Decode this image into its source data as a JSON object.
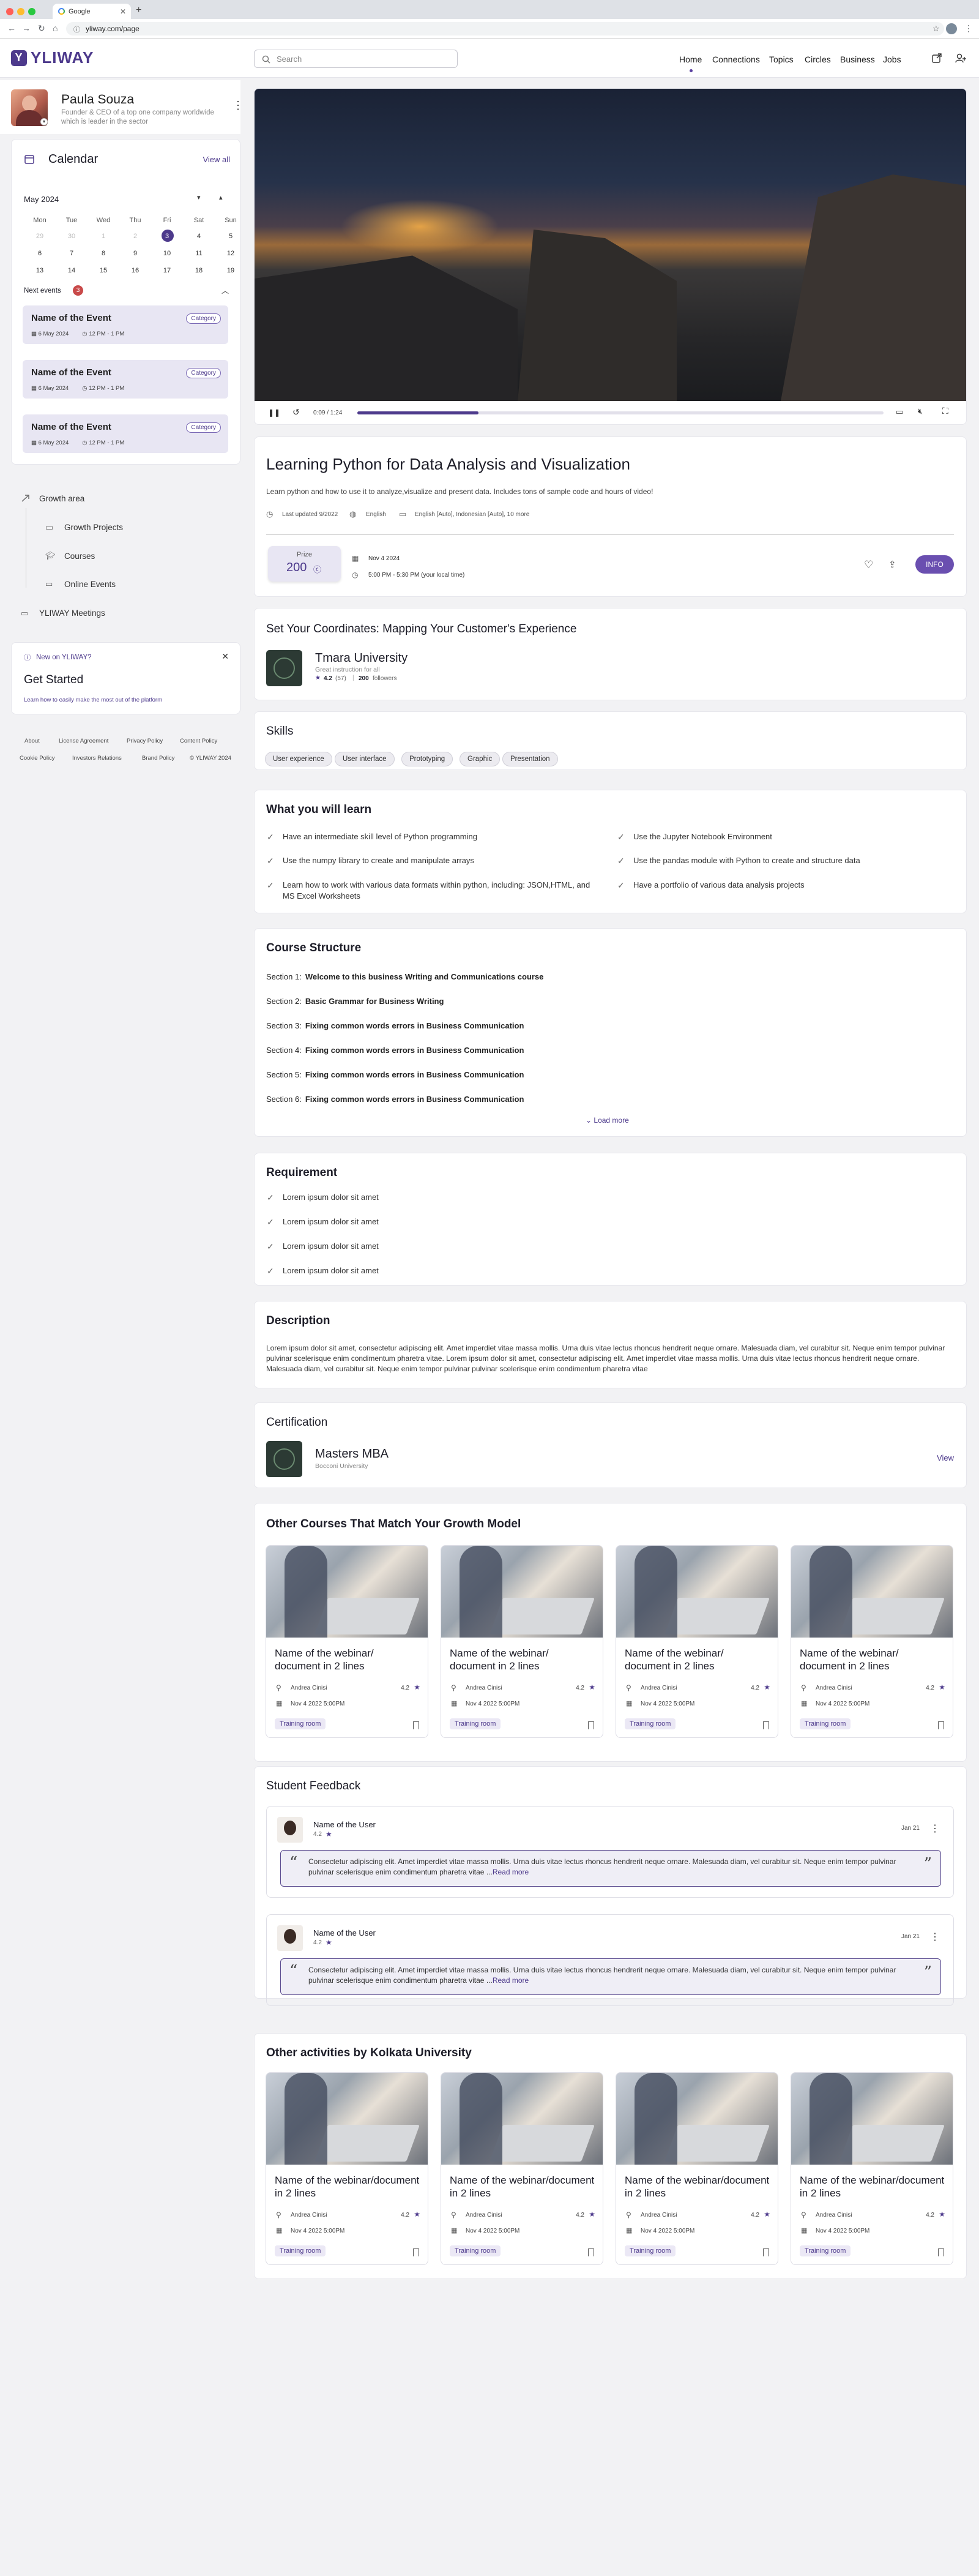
{
  "browser": {
    "tab_title": "Google",
    "url": "yliway.com/page"
  },
  "app": {
    "logo": "YLIWAY",
    "search_placeholder": "Search",
    "nav": [
      "Home",
      "Connections",
      "Topics",
      "Circles",
      "Business",
      "Jobs"
    ],
    "accent": "#4d3a8c"
  },
  "profile": {
    "name": "Paula Souza",
    "desc": "Founder & CEO of a top one company worldwide which is leader in the sector"
  },
  "calendar": {
    "title": "Calendar",
    "view_all": "View all",
    "month": "May 2024",
    "weekdays": [
      "Mon",
      "Tue",
      "Wed",
      "Thu",
      "Fri",
      "Sat",
      "Sun"
    ],
    "weeks": [
      [
        "29",
        "30",
        "1",
        "2",
        "3",
        "4",
        "5"
      ],
      [
        "6",
        "7",
        "8",
        "9",
        "10",
        "11",
        "12"
      ],
      [
        "13",
        "14",
        "15",
        "16",
        "17",
        "18",
        "19"
      ]
    ],
    "next_events_label": "Next events",
    "next_events_count": "3",
    "events": [
      {
        "title": "Name of the Event",
        "category": "Category",
        "date": "6 May 2024",
        "time": "12 PM - 1 PM"
      },
      {
        "title": "Name of the Event",
        "category": "Category",
        "date": "6 May 2024",
        "time": "12 PM - 1 PM"
      },
      {
        "title": "Name of the Event",
        "category": "Category",
        "date": "6 May 2024",
        "time": "12 PM - 1 PM"
      }
    ]
  },
  "sidebar": {
    "growth": "Growth area",
    "items": [
      "Growth Projects",
      "Courses",
      "Online Events"
    ],
    "meetings": "YLIWAY Meetings"
  },
  "banner": {
    "tag": "New on YLIWAY?",
    "title": "Get Started",
    "text": "Learn how to easily make the most out of the platform"
  },
  "footer": [
    "About",
    "License Agreement",
    "Privacy Policy",
    "Content Policy",
    "Cookie Policy",
    "Investors Relations",
    "Brand Policy",
    "© YLIWAY 2024"
  ],
  "video": {
    "time": "0:09 / 1:24",
    "progress": 0.23
  },
  "course": {
    "title": "Learning Python for Data Analysis and Visualization",
    "desc": "Learn python and how to use it to analyze,visualize and present data. Includes tons of sample code and hours of video!",
    "updated": "Last updated 9/2022",
    "language": "English",
    "subtitles": "English [Auto], Indonesian [Auto], 10 more",
    "price_label": "Prize",
    "price": "200",
    "date": "Nov 4 2024",
    "time": "5:00 PM - 5:30 PM (your local time)",
    "info_button": "INFO"
  },
  "coords": {
    "title": "Set Your Coordinates: Mapping Your Customer's Experience",
    "org": "Tmara University",
    "org_sub": "Great instruction for all",
    "rating": "4.2",
    "rating_count": "(57)",
    "followers": "200",
    "followers_label": "followers"
  },
  "skills": {
    "title": "Skills",
    "items": [
      "User experience",
      "User interface",
      "Prototyping",
      "Graphic",
      "Presentation"
    ]
  },
  "learn": {
    "title": "What you will learn",
    "items": [
      "Have an intermediate skill level of Python programming",
      "Use the Jupyter Notebook Environment",
      "Use the numpy library to create and manipulate arrays",
      "Use the pandas module with Python to create and structure data",
      "Learn how to work with various data formats within python, including: JSON,HTML, and MS Excel Worksheets",
      "Have a portfolio of various data analysis projects"
    ]
  },
  "structure": {
    "title": "Course Structure",
    "sections": [
      {
        "label": "Section 1:",
        "name": "Welcome to this business Writing and Communications course"
      },
      {
        "label": "Section 2:",
        "name": "Basic Grammar for Business Writing"
      },
      {
        "label": "Section 3:",
        "name": "Fixing common words errors in Business Communication"
      },
      {
        "label": "Section 4:",
        "name": "Fixing common words errors in Business Communication"
      },
      {
        "label": "Section 5:",
        "name": "Fixing common words errors in Business Communication"
      },
      {
        "label": "Section 6:",
        "name": "Fixing common words errors in Business Communication"
      }
    ],
    "load_more": "Load more"
  },
  "requirement": {
    "title": "Requirement",
    "items": [
      "Lorem ipsum dolor sit amet",
      "Lorem ipsum dolor sit amet",
      "Lorem ipsum dolor sit amet",
      "Lorem ipsum dolor sit amet"
    ]
  },
  "description": {
    "title": "Description",
    "text": "Lorem ipsum dolor sit amet, consectetur adipiscing elit. Amet imperdiet vitae massa mollis. Urna duis vitae lectus rhoncus hendrerit neque ornare. Malesuada diam, vel curabitur sit. Neque enim tempor pulvinar pulvinar scelerisque enim condimentum pharetra vitae. Lorem ipsum dolor sit amet, consectetur adipiscing elit. Amet imperdiet vitae massa mollis. Urna duis vitae lectus rhoncus hendrerit neque ornare. Malesuada diam, vel curabitur sit. Neque enim tempor pulvinar pulvinar scelerisque enim condimentum pharetra vitae"
  },
  "certification": {
    "title": "Certification",
    "name": "Masters MBA",
    "org": "Bocconi University",
    "view": "View"
  },
  "other_courses": {
    "title": "Other Courses That Match Your Growth Model",
    "cards": [
      {
        "title": "Name of the webinar/ document in 2 lines",
        "author": "Andrea Cinisi",
        "rating": "4.2",
        "date": "Nov 4 2022 5:00PM",
        "tag": "Training room"
      },
      {
        "title": "Name of the webinar/ document in 2 lines",
        "author": "Andrea Cinisi",
        "rating": "4.2",
        "date": "Nov 4 2022 5:00PM",
        "tag": "Training room"
      },
      {
        "title": "Name of the webinar/ document in 2 lines",
        "author": "Andrea Cinisi",
        "rating": "4.2",
        "date": "Nov 4 2022 5:00PM",
        "tag": "Training room"
      },
      {
        "title": "Name of the webinar/ document in 2 lines",
        "author": "Andrea Cinisi",
        "rating": "4.2",
        "date": "Nov 4 2022 5:00PM",
        "tag": "Training room"
      }
    ]
  },
  "feedback": {
    "title": "Student Feedback",
    "items": [
      {
        "user": "Name of the User",
        "rating": "4.2",
        "date": "Jan 21",
        "text": "Consectetur adipiscing elit. Amet imperdiet vitae massa mollis. Urna duis vitae lectus rhoncus hendrerit neque ornare. Malesuada diam, vel curabitur sit. Neque enim tempor pulvinar pulvinar scelerisque enim condimentum pharetra vitae ...",
        "more": "Read more"
      },
      {
        "user": "Name of the User",
        "rating": "4.2",
        "date": "Jan 21",
        "text": "Consectetur adipiscing elit. Amet imperdiet vitae massa mollis. Urna duis vitae lectus rhoncus hendrerit neque ornare. Malesuada diam, vel curabitur sit. Neque enim tempor pulvinar pulvinar scelerisque enim condimentum pharetra vitae ...",
        "more": "Read more"
      }
    ]
  },
  "other_activities": {
    "title": "Other activities by Kolkata University",
    "cards": [
      {
        "title": "Name of the webinar/document in 2 lines",
        "author": "Andrea Cinisi",
        "rating": "4.2",
        "date": "Nov 4 2022 5:00PM",
        "tag": "Training room"
      },
      {
        "title": "Name of the webinar/document in 2 lines",
        "author": "Andrea Cinisi",
        "rating": "4.2",
        "date": "Nov 4 2022 5:00PM",
        "tag": "Training room"
      },
      {
        "title": "Name of the webinar/document in 2 lines",
        "author": "Andrea Cinisi",
        "rating": "4.2",
        "date": "Nov 4 2022 5:00PM",
        "tag": "Training room"
      },
      {
        "title": "Name of the webinar/document in 2 lines",
        "author": "Andrea Cinisi",
        "rating": "4.2",
        "date": "Nov 4 2022 5:00PM",
        "tag": "Training room"
      }
    ]
  }
}
